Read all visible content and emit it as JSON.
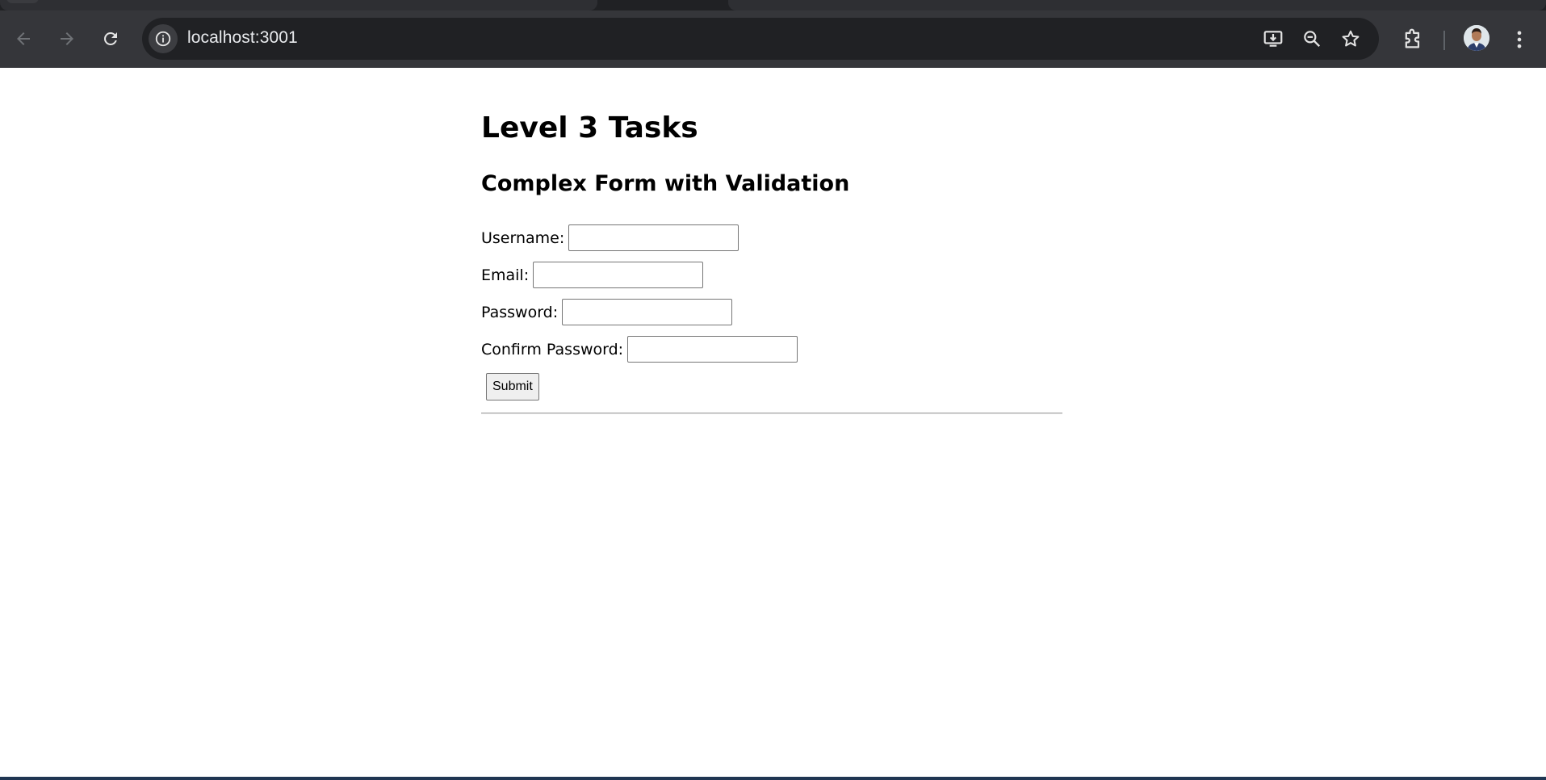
{
  "browser": {
    "url": "localhost:3001",
    "icons": {
      "back": "arrow-left-icon",
      "forward": "arrow-right-icon",
      "reload": "reload-icon",
      "site_info": "info-icon",
      "install": "install-app-icon",
      "zoom": "zoom-out-icon",
      "bookmark": "star-icon",
      "extensions": "puzzle-icon",
      "menu": "kebab-menu-icon"
    }
  },
  "page": {
    "title": "Level 3 Tasks",
    "form_title": "Complex Form with Validation",
    "fields": [
      {
        "label": "Username:",
        "value": ""
      },
      {
        "label": "Email:",
        "value": ""
      },
      {
        "label": "Password:",
        "value": ""
      },
      {
        "label": "Confirm Password:",
        "value": ""
      }
    ],
    "submit_label": "Submit"
  },
  "colors": {
    "chrome_bg": "#35363a",
    "omnibox_bg": "#202124",
    "page_bg": "#ffffff",
    "text": "#000000"
  }
}
